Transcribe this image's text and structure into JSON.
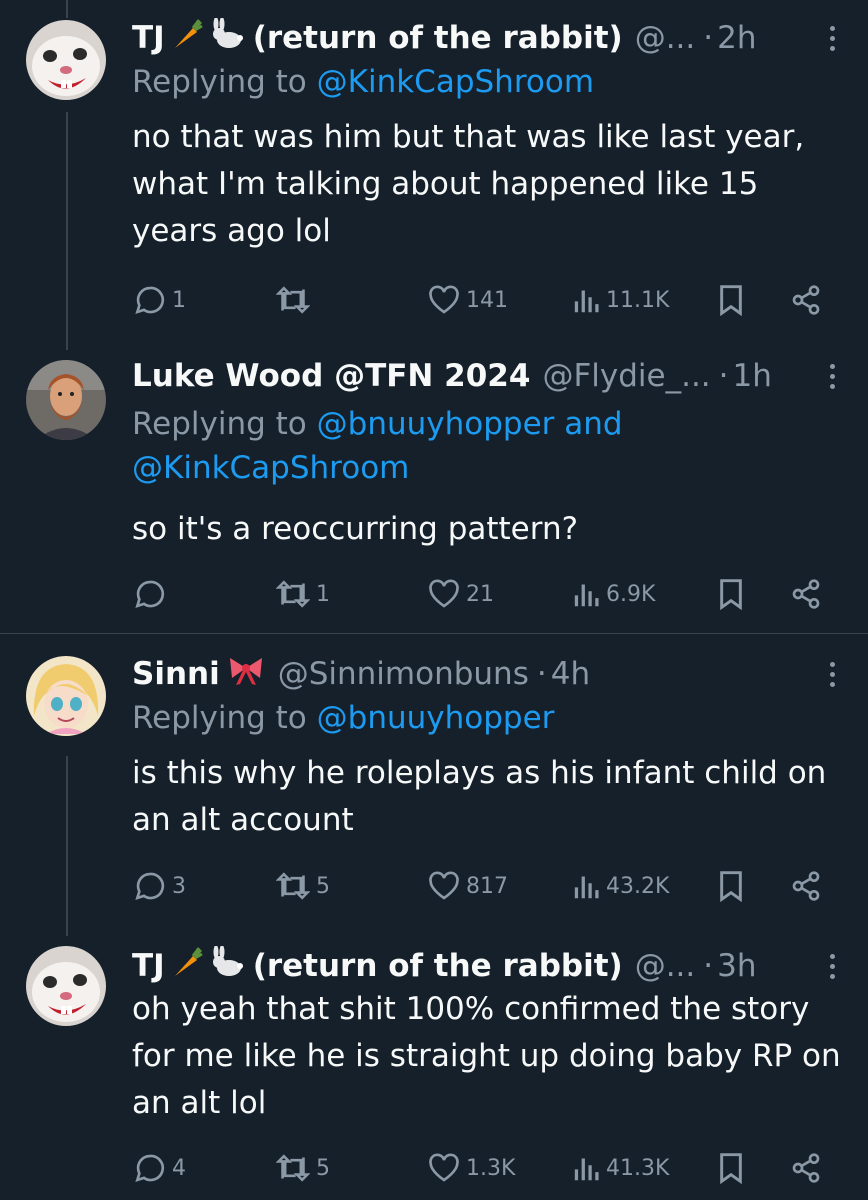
{
  "colors": {
    "background": "#15202b",
    "text_primary": "#f7f9f9",
    "text_secondary": "#8b98a5",
    "link": "#1d9bf0",
    "divider": "#38444d"
  },
  "tweets": [
    {
      "name": "TJ",
      "emoji_icons": [
        "carrot-icon",
        "rabbit-icon"
      ],
      "name_suffix": "(return of the rabbit)",
      "handle": "@...",
      "dot": "·",
      "time": "2h",
      "replying_prefix": "Replying to",
      "replying_to": "@KinkCapShroom",
      "replying_to_2": "",
      "text": "no that was him but that was like last year, what I'm talking about happened like 15 years ago lol",
      "replies": "1",
      "retweets": "",
      "likes": "141",
      "views": "11.1K"
    },
    {
      "name": "Luke Wood @TFN 2024",
      "emoji_icons": [],
      "name_suffix": "",
      "handle": "@Flydie_...",
      "dot": "·",
      "time": "1h",
      "replying_prefix": "Replying to",
      "replying_to": "@bnuuyhopper and",
      "replying_to_2": "@KinkCapShroom",
      "text": "so it's a reoccurring pattern?",
      "replies": "",
      "retweets": "1",
      "likes": "21",
      "views": "6.9K"
    },
    {
      "name": "Sinni",
      "emoji_icons": [
        "ribbon-icon"
      ],
      "name_suffix": "",
      "handle": "@Sinnimonbuns",
      "dot": "·",
      "time": "4h",
      "replying_prefix": "Replying to",
      "replying_to": "@bnuuyhopper",
      "replying_to_2": "",
      "text": "is this why he roleplays as his infant child on an alt account",
      "replies": "3",
      "retweets": "5",
      "likes": "817",
      "views": "43.2K"
    },
    {
      "name": "TJ",
      "emoji_icons": [
        "carrot-icon",
        "rabbit-icon"
      ],
      "name_suffix": "(return of the rabbit)",
      "handle": "@...",
      "dot": "·",
      "time": "3h",
      "replying_prefix": "",
      "replying_to": "",
      "replying_to_2": "",
      "text": "oh yeah that shit 100% confirmed the story for me like he is straight up doing baby RP on an alt lol",
      "replies": "4",
      "retweets": "5",
      "likes": "1.3K",
      "views": "41.3K"
    }
  ]
}
